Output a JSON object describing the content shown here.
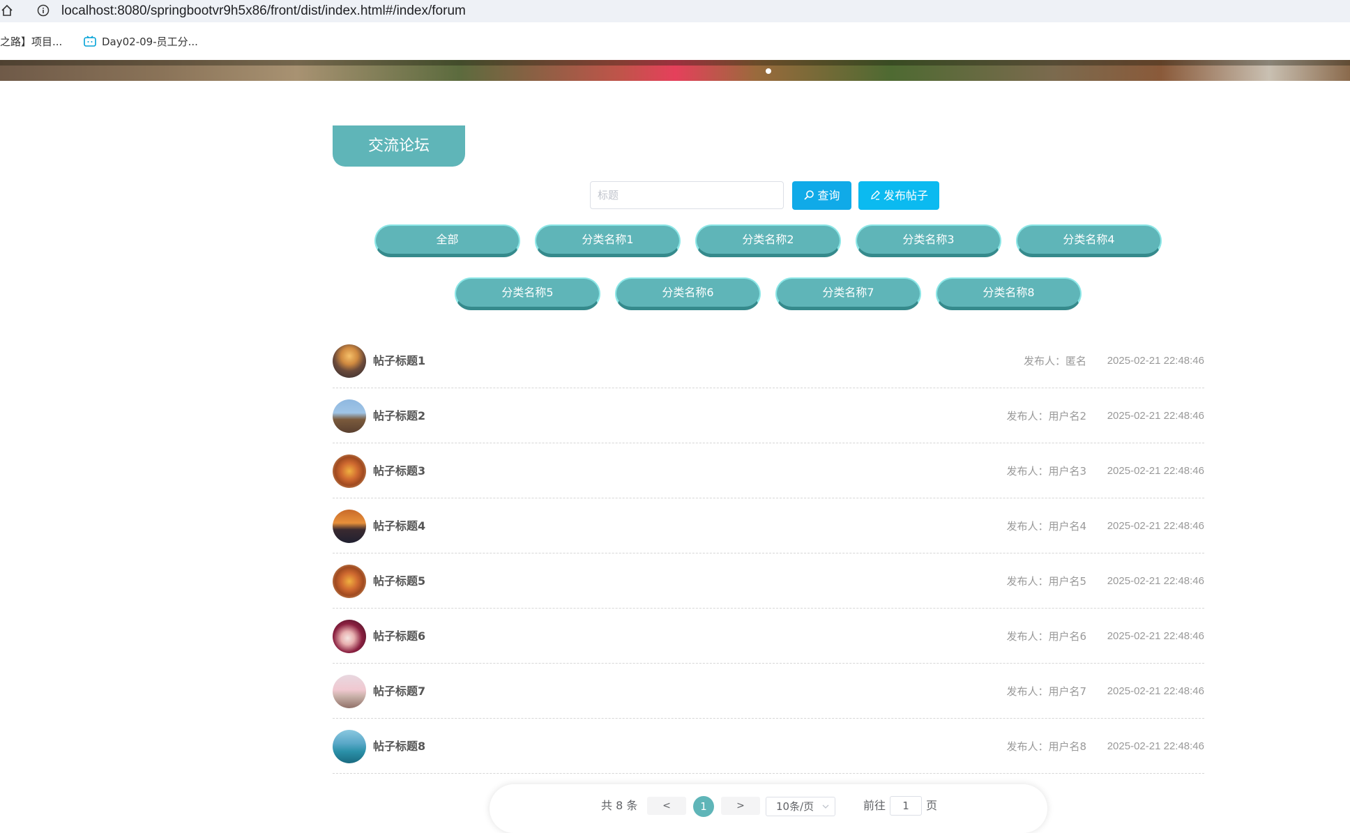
{
  "browser": {
    "url": "localhost:8080/springbootvr9h5x86/front/dist/index.html#/index/forum",
    "bookmarks": [
      "之路】项目...",
      "Day02-09-员工分..."
    ]
  },
  "forum": {
    "title": "交流论坛",
    "search_placeholder": "标题",
    "search_button": "查询",
    "post_button": "发布帖子"
  },
  "categories": [
    "全部",
    "分类名称1",
    "分类名称2",
    "分类名称3",
    "分类名称4",
    "分类名称5",
    "分类名称6",
    "分类名称7",
    "分类名称8"
  ],
  "posts": [
    {
      "title": "帖子标题1",
      "author": "发布人：匿名",
      "time": "2025-02-21 22:48:46"
    },
    {
      "title": "帖子标题2",
      "author": "发布人：用户名2",
      "time": "2025-02-21 22:48:46"
    },
    {
      "title": "帖子标题3",
      "author": "发布人：用户名3",
      "time": "2025-02-21 22:48:46"
    },
    {
      "title": "帖子标题4",
      "author": "发布人：用户名4",
      "time": "2025-02-21 22:48:46"
    },
    {
      "title": "帖子标题5",
      "author": "发布人：用户名5",
      "time": "2025-02-21 22:48:46"
    },
    {
      "title": "帖子标题6",
      "author": "发布人：用户名6",
      "time": "2025-02-21 22:48:46"
    },
    {
      "title": "帖子标题7",
      "author": "发布人：用户名7",
      "time": "2025-02-21 22:48:46"
    },
    {
      "title": "帖子标题8",
      "author": "发布人：用户名8",
      "time": "2025-02-21 22:48:46"
    }
  ],
  "pagination": {
    "total": "共 8 条",
    "prev": "<",
    "current": "1",
    "next": ">",
    "page_size": "10条/页",
    "goto_label": "前往",
    "goto_value": "1",
    "page_label": "页"
  },
  "colors": {
    "accent": "#5fb5b8",
    "button_blue": "#0bbaf0"
  }
}
